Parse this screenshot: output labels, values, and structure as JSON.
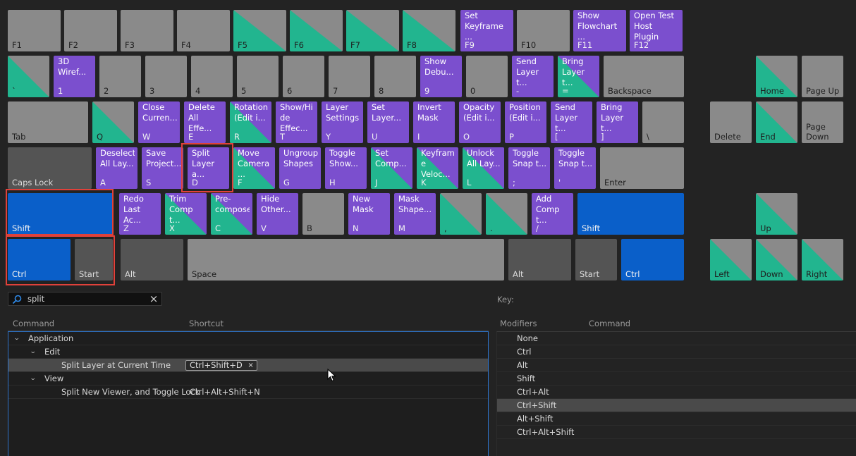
{
  "keyboard": {
    "keys": [
      {
        "label": "F1",
        "cmd": "",
        "style": "grey",
        "hl": false
      },
      {
        "label": "F2",
        "cmd": "",
        "style": "grey",
        "hl": false
      },
      {
        "label": "F3",
        "cmd": "",
        "style": "grey",
        "hl": false
      },
      {
        "label": "F4",
        "cmd": "",
        "style": "grey",
        "hl": false
      },
      {
        "label": "F5",
        "cmd": "",
        "style": "diag-grey",
        "hl": false
      },
      {
        "label": "F6",
        "cmd": "",
        "style": "diag-grey",
        "hl": false
      },
      {
        "label": "F7",
        "cmd": "",
        "style": "diag-grey",
        "hl": false
      },
      {
        "label": "F8",
        "cmd": "",
        "style": "diag-grey",
        "hl": false
      },
      {
        "label": "F9",
        "cmd": "Set\nKeyframe\n...",
        "style": "purple",
        "hl": false
      },
      {
        "label": "F10",
        "cmd": "",
        "style": "grey",
        "hl": false
      },
      {
        "label": "F11",
        "cmd": "Show\nFlowchart ...",
        "style": "purple",
        "hl": false
      },
      {
        "label": "F12",
        "cmd": "Open Test\nHost Plugin",
        "style": "purple",
        "hl": false
      },
      {
        "label": "`",
        "cmd": "",
        "style": "diag-grey",
        "hl": false
      },
      {
        "label": "1",
        "cmd": "3D\nWiref...",
        "style": "purple",
        "hl": false
      },
      {
        "label": "2",
        "cmd": "",
        "style": "grey",
        "hl": false
      },
      {
        "label": "3",
        "cmd": "",
        "style": "grey",
        "hl": false
      },
      {
        "label": "4",
        "cmd": "",
        "style": "grey",
        "hl": false
      },
      {
        "label": "5",
        "cmd": "",
        "style": "grey",
        "hl": false
      },
      {
        "label": "6",
        "cmd": "",
        "style": "grey",
        "hl": false
      },
      {
        "label": "7",
        "cmd": "",
        "style": "grey",
        "hl": false
      },
      {
        "label": "8",
        "cmd": "",
        "style": "grey",
        "hl": false
      },
      {
        "label": "9",
        "cmd": "Show\nDebu...",
        "style": "purple",
        "hl": false
      },
      {
        "label": "0",
        "cmd": "",
        "style": "grey",
        "hl": false
      },
      {
        "label": "-",
        "cmd": "Send\nLayer t...",
        "style": "purple",
        "hl": false
      },
      {
        "label": "=",
        "cmd": "Bring\nLayer t...",
        "style": "diag-purple",
        "hl": false
      },
      {
        "label": "Backspace",
        "cmd": "",
        "style": "grey",
        "hl": false
      },
      {
        "label": "Home",
        "cmd": "",
        "style": "diag-grey",
        "hl": false
      },
      {
        "label": "Page Up",
        "cmd": "",
        "style": "grey",
        "hl": false
      },
      {
        "label": "Tab",
        "cmd": "",
        "style": "grey",
        "hl": false
      },
      {
        "label": "Q",
        "cmd": "",
        "style": "diag-grey",
        "hl": false
      },
      {
        "label": "W",
        "cmd": "Close\nCurren...",
        "style": "purple",
        "hl": false
      },
      {
        "label": "E",
        "cmd": "Delete\nAll Effe...",
        "style": "purple",
        "hl": false
      },
      {
        "label": "R",
        "cmd": "Rotation\n(Edit i...",
        "style": "diag-purple",
        "hl": false
      },
      {
        "label": "T",
        "cmd": "Show/Hi\nde\nEffec...",
        "style": "purple",
        "hl": false
      },
      {
        "label": "Y",
        "cmd": "Layer\nSettings",
        "style": "purple",
        "hl": false
      },
      {
        "label": "U",
        "cmd": "Set\nLayer...",
        "style": "purple",
        "hl": false
      },
      {
        "label": "I",
        "cmd": "Invert\nMask",
        "style": "purple",
        "hl": false
      },
      {
        "label": "O",
        "cmd": "Opacity\n(Edit i...",
        "style": "purple",
        "hl": false
      },
      {
        "label": "P",
        "cmd": "Position\n(Edit i...",
        "style": "purple",
        "hl": false
      },
      {
        "label": "[",
        "cmd": "Send\nLayer t...",
        "style": "purple",
        "hl": false
      },
      {
        "label": "]",
        "cmd": "Bring\nLayer t...",
        "style": "purple",
        "hl": false
      },
      {
        "label": "\\",
        "cmd": "",
        "style": "grey",
        "hl": false
      },
      {
        "label": "Delete",
        "cmd": "",
        "style": "grey",
        "hl": false
      },
      {
        "label": "End",
        "cmd": "",
        "style": "diag-grey",
        "hl": false
      },
      {
        "label": "Page\nDown",
        "cmd": "",
        "style": "grey",
        "hl": false
      },
      {
        "label": "Caps Lock",
        "cmd": "",
        "style": "mod",
        "hl": false
      },
      {
        "label": "A",
        "cmd": "Deselect\nAll Lay...",
        "style": "purple",
        "hl": false
      },
      {
        "label": "S",
        "cmd": "Save\nProject...",
        "style": "purple",
        "hl": false
      },
      {
        "label": "D",
        "cmd": "Split\nLayer\na...",
        "style": "purple",
        "hl": true
      },
      {
        "label": "F",
        "cmd": "Move\nCamera\n...",
        "style": "diag-purple",
        "hl": false
      },
      {
        "label": "G",
        "cmd": "Ungroup\nShapes",
        "style": "purple",
        "hl": false
      },
      {
        "label": "H",
        "cmd": "Toggle\nShow...",
        "style": "purple",
        "hl": false
      },
      {
        "label": "J",
        "cmd": "Set\nComp...",
        "style": "diag-purple",
        "hl": false
      },
      {
        "label": "K",
        "cmd": "Keyfram\ne\nVeloc...",
        "style": "diag-purple",
        "hl": false
      },
      {
        "label": "L",
        "cmd": "Unlock\nAll Lay...",
        "style": "diag-purple",
        "hl": false
      },
      {
        "label": ";",
        "cmd": "Toggle\nSnap t...",
        "style": "purple",
        "hl": false
      },
      {
        "label": "'",
        "cmd": "Toggle\nSnap t...",
        "style": "purple",
        "hl": false
      },
      {
        "label": "Enter",
        "cmd": "",
        "style": "grey",
        "hl": false
      },
      {
        "label": "Shift",
        "cmd": "",
        "style": "blue",
        "hl": false
      },
      {
        "label": "Z",
        "cmd": "Redo\nLast\nAc...",
        "style": "purple",
        "hl": false
      },
      {
        "label": "X",
        "cmd": "Trim\nComp\nt...",
        "style": "diag-purple",
        "hl": false
      },
      {
        "label": "C",
        "cmd": "Pre-\ncompose",
        "style": "diag-purple",
        "hl": false
      },
      {
        "label": "V",
        "cmd": "Hide\nOther...",
        "style": "purple",
        "hl": false
      },
      {
        "label": "B",
        "cmd": "",
        "style": "grey",
        "hl": false
      },
      {
        "label": "N",
        "cmd": "New\nMask",
        "style": "purple",
        "hl": false
      },
      {
        "label": "M",
        "cmd": "Mask\nShape...",
        "style": "purple",
        "hl": false
      },
      {
        "label": ",",
        "cmd": "",
        "style": "diag-grey",
        "hl": false
      },
      {
        "label": ".",
        "cmd": "",
        "style": "diag-grey",
        "hl": false
      },
      {
        "label": "/",
        "cmd": "Add\nComp\nt...",
        "style": "purple",
        "hl": false
      },
      {
        "label": "Shift",
        "cmd": "",
        "style": "blue",
        "hl": false
      },
      {
        "label": "Up",
        "cmd": "",
        "style": "diag-grey",
        "hl": false
      },
      {
        "label": "Ctrl",
        "cmd": "",
        "style": "blue",
        "hl": false
      },
      {
        "label": "Start",
        "cmd": "",
        "style": "mod",
        "hl": false
      },
      {
        "label": "Alt",
        "cmd": "",
        "style": "mod",
        "hl": false
      },
      {
        "label": "Space",
        "cmd": "",
        "style": "grey",
        "hl": false
      },
      {
        "label": "Alt",
        "cmd": "",
        "style": "mod",
        "hl": false
      },
      {
        "label": "Start",
        "cmd": "",
        "style": "mod",
        "hl": false
      },
      {
        "label": "Ctrl",
        "cmd": "",
        "style": "blue",
        "hl": false
      },
      {
        "label": "Left",
        "cmd": "",
        "style": "diag-grey",
        "hl": false
      },
      {
        "label": "Down",
        "cmd": "",
        "style": "diag-grey",
        "hl": false
      },
      {
        "label": "Right",
        "cmd": "",
        "style": "diag-grey",
        "hl": false
      }
    ]
  },
  "search": {
    "value": "split",
    "icon": "search-icon",
    "clear_icon": "×"
  },
  "commands": {
    "headers": {
      "command": "Command",
      "shortcut": "Shortcut"
    },
    "rows": [
      {
        "kind": "group",
        "depth": 0,
        "text": "Application",
        "shortcut": "",
        "selected": false
      },
      {
        "kind": "group",
        "depth": 1,
        "text": "Edit",
        "shortcut": "",
        "selected": false
      },
      {
        "kind": "item",
        "depth": 2,
        "text": "Split Layer at Current Time",
        "shortcut": "Ctrl+Shift+D",
        "selected": true,
        "editing": true
      },
      {
        "kind": "group",
        "depth": 1,
        "text": "View",
        "shortcut": "",
        "selected": false
      },
      {
        "kind": "item",
        "depth": 2,
        "text": "Split New Viewer, and Toggle Lock",
        "shortcut": "Ctrl+Alt+Shift+N",
        "selected": false,
        "editing": false
      }
    ],
    "remove_icon": "×"
  },
  "key_panel": {
    "title": "Key:",
    "headers": {
      "modifiers": "Modifiers",
      "command": "Command"
    },
    "modifiers": [
      "None",
      "Ctrl",
      "Alt",
      "Shift",
      "Ctrl+Alt",
      "Ctrl+Shift",
      "Alt+Shift",
      "Ctrl+Alt+Shift"
    ],
    "selected_index": 5
  },
  "colors": {
    "purple": "#7b4fce",
    "green": "#22b58f",
    "blue": "#0a5fc9",
    "grey": "#8a8a8a",
    "highlight": "#e0413a",
    "focus": "#2f74c9"
  }
}
